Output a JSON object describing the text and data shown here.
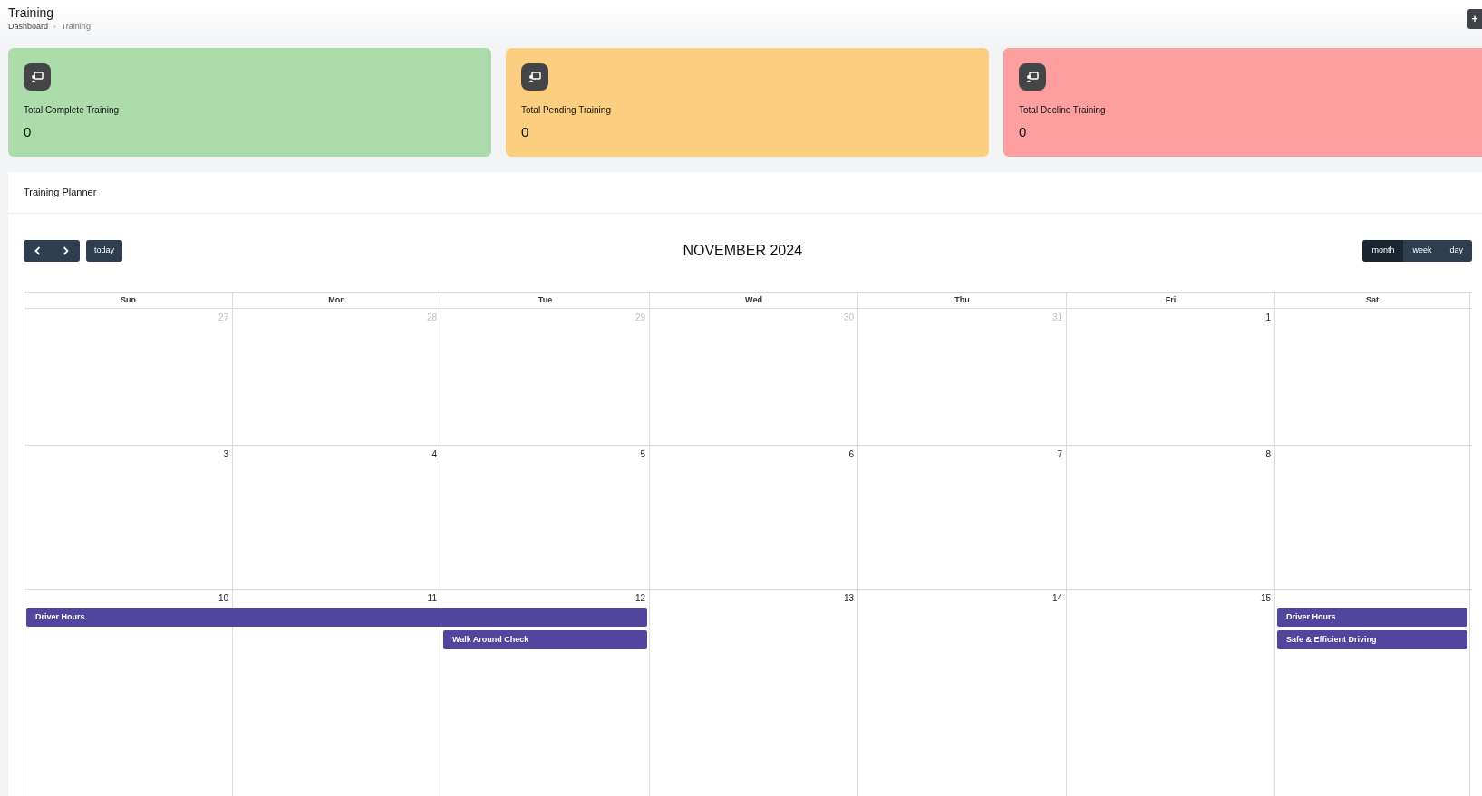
{
  "header": {
    "title": "Training",
    "breadcrumb": [
      "Dashboard",
      "Training"
    ],
    "breadcrumb_separator": "›",
    "add_button": "+"
  },
  "stats": [
    {
      "label": "Total Complete Training",
      "value": "0",
      "color": "#abdcaa"
    },
    {
      "label": "Total Pending Training",
      "value": "0",
      "color": "#fbce80"
    },
    {
      "label": "Total Decline Training",
      "value": "0",
      "color": "#fe9f9f"
    }
  ],
  "planner": {
    "title": "Training Planner",
    "today": "today",
    "month_title": "NOVEMBER 2024",
    "views": [
      {
        "label": "month",
        "selected": true
      },
      {
        "label": "week",
        "selected": false
      },
      {
        "label": "day",
        "selected": false
      }
    ],
    "weekdays": [
      "Sun",
      "Mon",
      "Tue",
      "Wed",
      "Thu",
      "Fri",
      "Sat"
    ],
    "weeks": [
      {
        "days": [
          {
            "num": "27",
            "other_month": true
          },
          {
            "num": "28",
            "other_month": true
          },
          {
            "num": "29",
            "other_month": true
          },
          {
            "num": "30",
            "other_month": true
          },
          {
            "num": "31",
            "other_month": true
          },
          {
            "num": "1",
            "other_month": false
          }
        ]
      },
      {
        "days": [
          {
            "num": "3",
            "other_month": false
          },
          {
            "num": "4",
            "other_month": false
          },
          {
            "num": "5",
            "other_month": false
          },
          {
            "num": "6",
            "other_month": false
          },
          {
            "num": "7",
            "other_month": false
          },
          {
            "num": "8",
            "other_month": false
          }
        ]
      },
      {
        "days": [
          {
            "num": "10",
            "other_month": false,
            "events": [
              {
                "kind": "start",
                "title": "Driver Hours"
              }
            ]
          },
          {
            "num": "11",
            "other_month": false,
            "events": [
              {
                "kind": "continue"
              }
            ]
          },
          {
            "num": "12",
            "other_month": false,
            "events": [
              {
                "kind": "continue"
              },
              {
                "kind": "start",
                "title": "Walk Around Check"
              }
            ]
          },
          {
            "num": "13",
            "other_month": false
          },
          {
            "num": "14",
            "other_month": false
          },
          {
            "num": "15",
            "other_month": false
          },
          {
            "events": [
              {
                "kind": "start",
                "title": "Driver Hours"
              },
              {
                "kind": "start",
                "title": "Safe & Efficient Driving"
              }
            ]
          }
        ]
      }
    ]
  }
}
